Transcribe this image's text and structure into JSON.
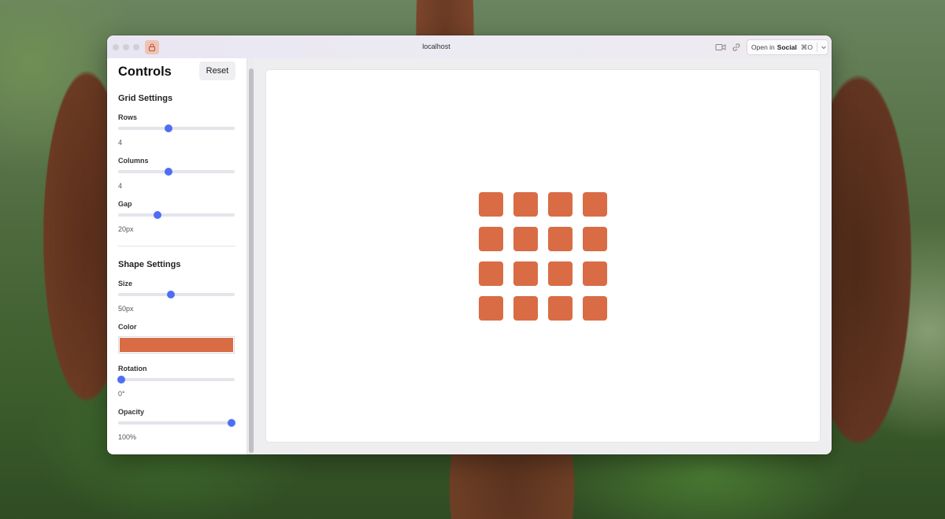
{
  "browser": {
    "url": "localhost",
    "open_in_prefix": "Open in",
    "open_in_app": "Social",
    "open_in_shortcut": "⌘O",
    "icons": [
      "lock-icon",
      "camera-icon",
      "link-icon",
      "chevron-down-icon"
    ]
  },
  "sidebar": {
    "title": "Controls",
    "reset_label": "Reset",
    "grid_section": {
      "title": "Grid Settings",
      "rows": {
        "label": "Rows",
        "value": "4",
        "fraction": 0.43
      },
      "columns": {
        "label": "Columns",
        "value": "4",
        "fraction": 0.43
      },
      "gap": {
        "label": "Gap",
        "value": "20px",
        "fraction": 0.34
      }
    },
    "shape_section": {
      "title": "Shape Settings",
      "size": {
        "label": "Size",
        "value": "50px",
        "fraction": 0.45
      },
      "color": {
        "label": "Color",
        "value": "#d96c45"
      },
      "rotation": {
        "label": "Rotation",
        "value": "0°",
        "fraction": 0.03
      },
      "opacity": {
        "label": "Opacity",
        "value": "100%",
        "fraction": 0.97
      }
    }
  },
  "canvas": {
    "rows": 4,
    "columns": 4,
    "gap": 20,
    "size": 50,
    "rotation": 0,
    "opacity": 1,
    "color": "#d96c45"
  },
  "colors": {
    "accent": "#4f6ef5",
    "shape": "#d96c45"
  }
}
